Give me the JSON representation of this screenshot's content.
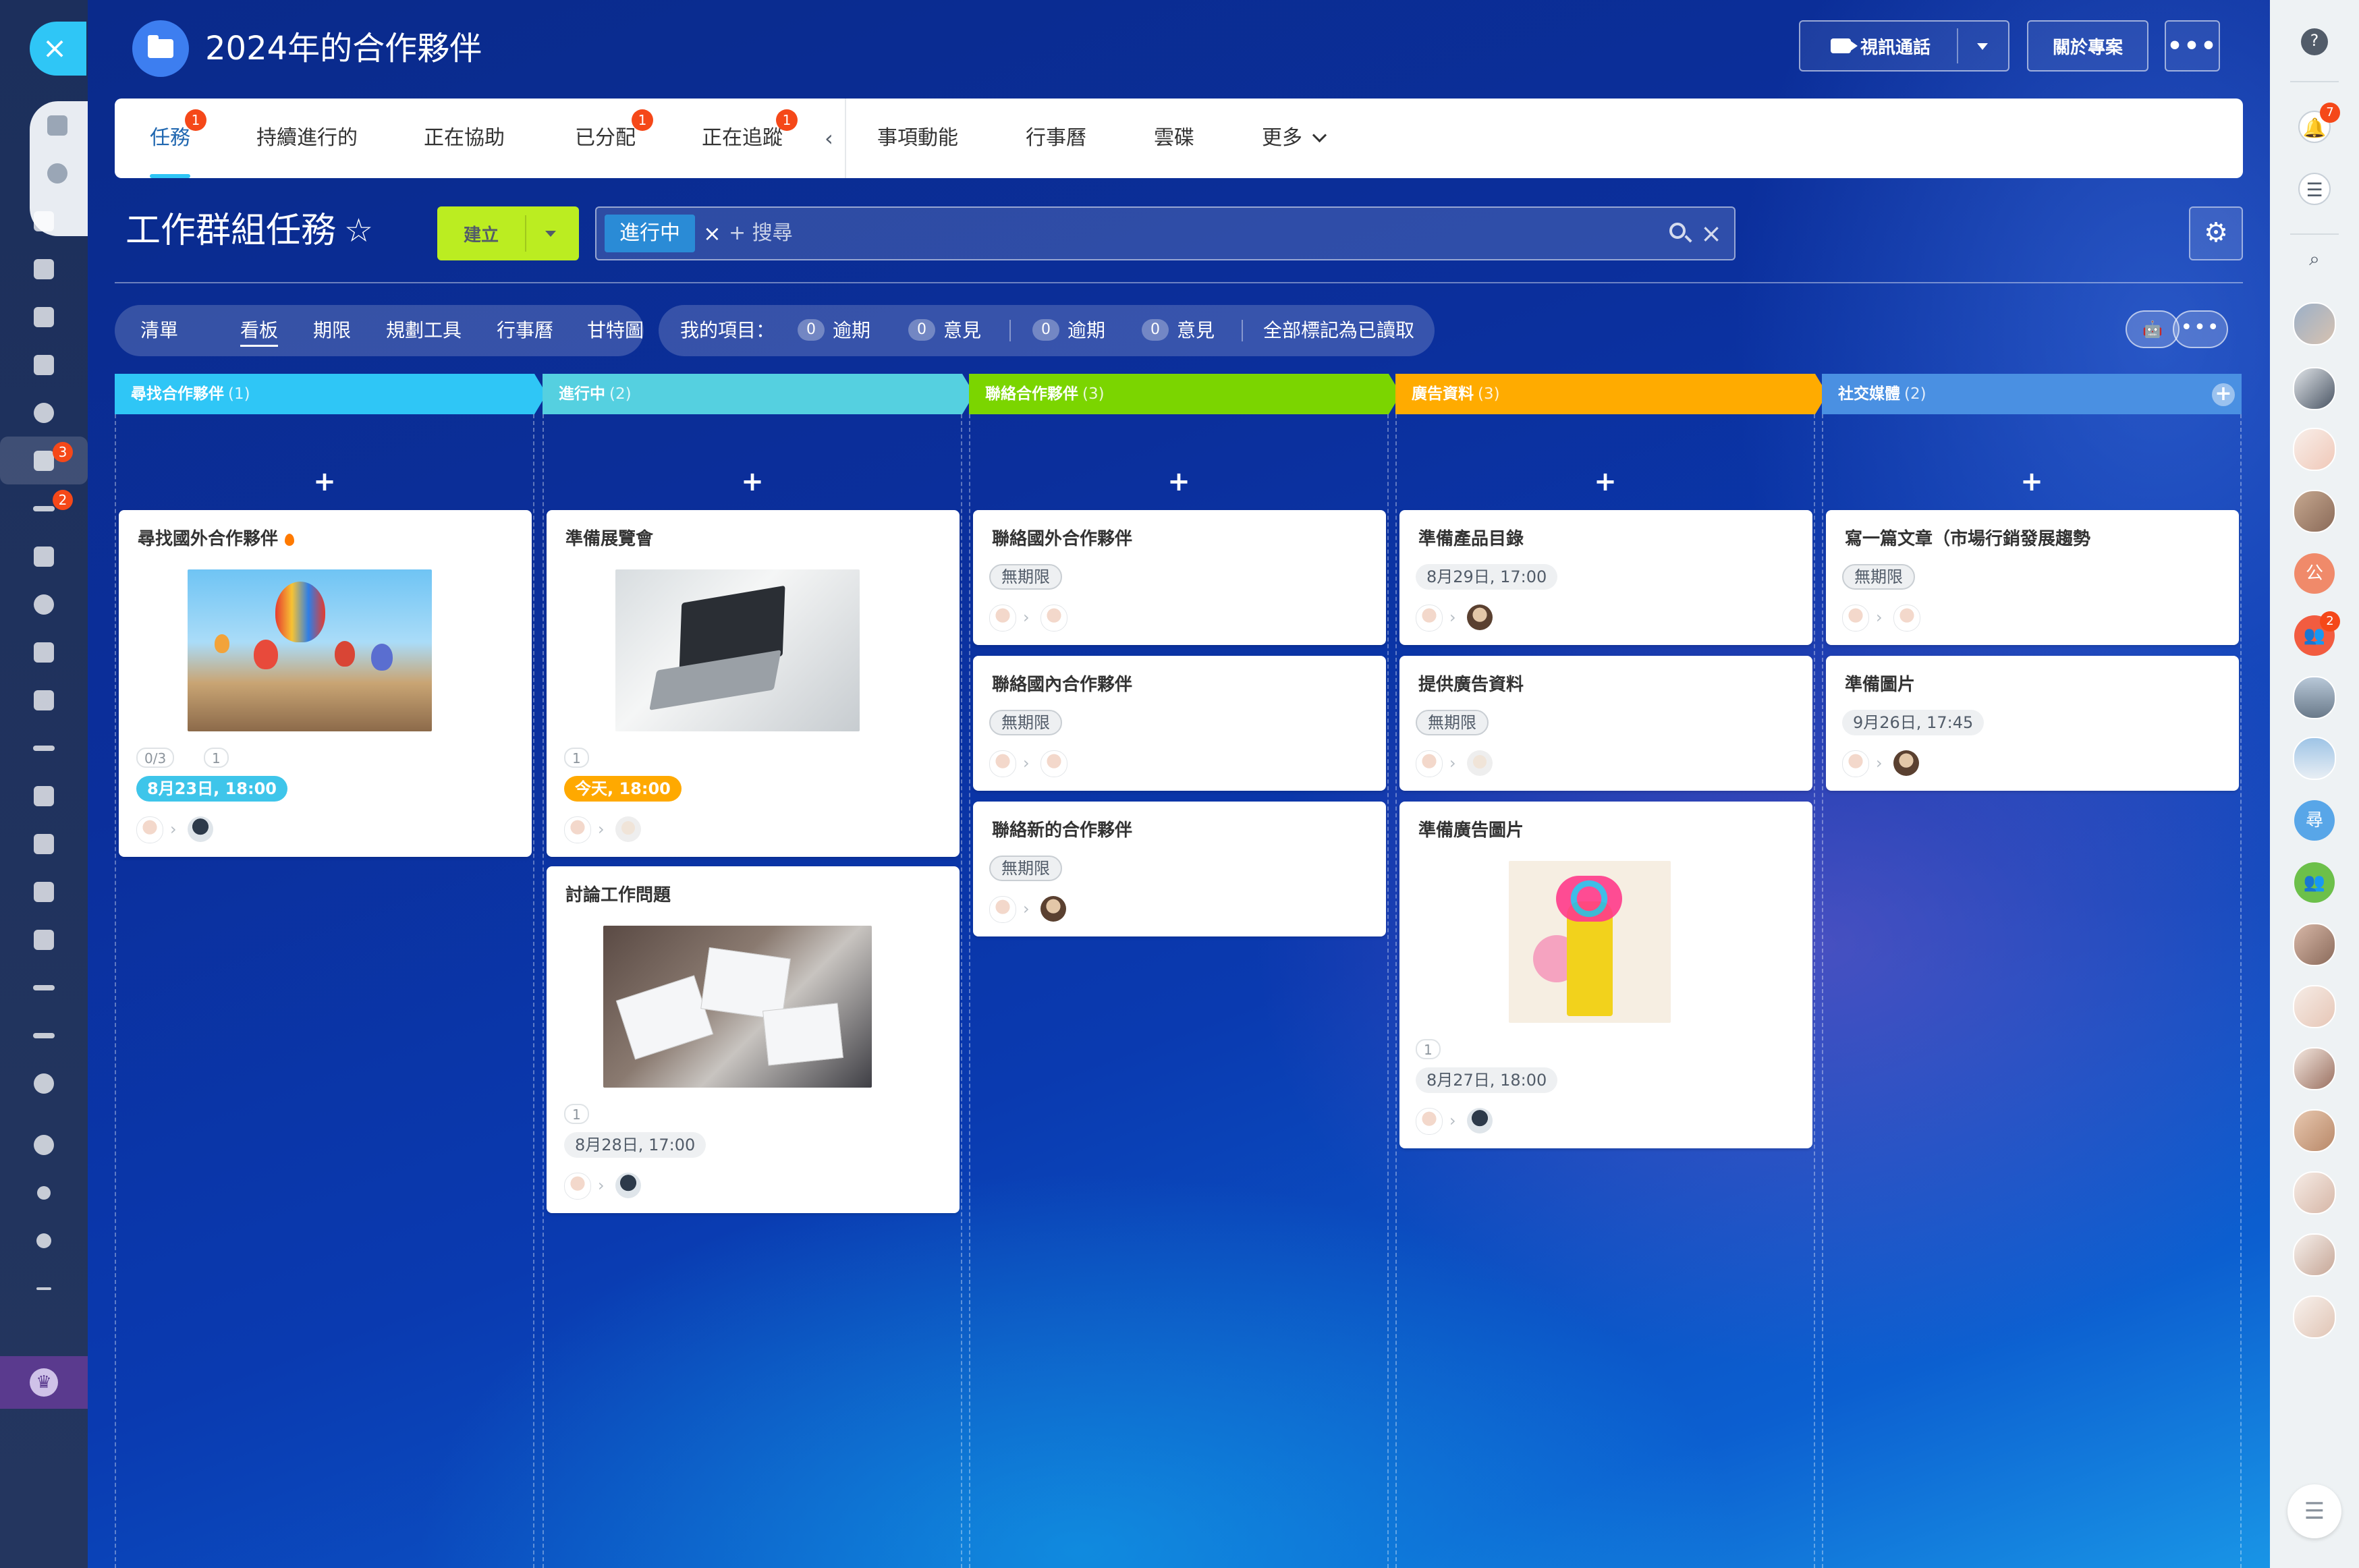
{
  "project": {
    "title": "2024年的合作夥伴",
    "video_call_label": "視訊通話",
    "about_label": "關於專案",
    "more_label": "•••"
  },
  "tabs": [
    {
      "label": "任務",
      "badge": "1"
    },
    {
      "label": "持續進行的",
      "badge": ""
    },
    {
      "label": "正在協助",
      "badge": ""
    },
    {
      "label": "已分配",
      "badge": "1"
    },
    {
      "label": "正在追蹤",
      "badge": "1"
    },
    {
      "label": "事項動能",
      "badge": ""
    },
    {
      "label": "行事曆",
      "badge": ""
    },
    {
      "label": "雲碟",
      "badge": ""
    },
    {
      "label": "更多",
      "badge": ""
    }
  ],
  "tabs_collapse_arrow": "‹",
  "page": {
    "title": "工作群組任務",
    "star": "☆",
    "create_label": "建立"
  },
  "search": {
    "chip": "進行中",
    "chip_remove": "×",
    "placeholder": "+ 搜尋",
    "clear": "×"
  },
  "settings_icon": "⚙",
  "views": [
    "清單",
    "看板",
    "期限",
    "規劃工具",
    "行事曆",
    "甘特圖"
  ],
  "counters": {
    "my_items_label": "我的項目：",
    "group1": [
      {
        "num": "0",
        "label": "逾期"
      },
      {
        "num": "0",
        "label": "意見"
      }
    ],
    "group2": [
      {
        "num": "0",
        "label": "逾期"
      },
      {
        "num": "0",
        "label": "意見"
      }
    ],
    "mark_all_read": "全部標記為已讀取"
  },
  "robot_icon": "🤖",
  "dots_label": "•••",
  "add_symbol": "+",
  "columns": [
    {
      "title": "尋找合作夥伴",
      "count": "(1)",
      "color": "#2fc6f6",
      "cards": [
        {
          "title": "尋找國外合作夥伴",
          "hot": true,
          "image": "balloons",
          "checklist": "0/3",
          "files": "1",
          "date": "8月23日, 18:00",
          "date_style": "blue"
        }
      ]
    },
    {
      "title": "進行中",
      "count": "(2)",
      "color": "#55d0e0",
      "cards": [
        {
          "title": "準備展覽會",
          "image": "laptop",
          "files": "1",
          "date": "今天, 18:00",
          "date_style": "orange"
        },
        {
          "title": "討論工作問題",
          "image": "meeting",
          "files": "1",
          "date": "8月28日, 17:00",
          "date_style": "plain"
        }
      ]
    },
    {
      "title": "聯絡合作夥伴",
      "count": "(3)",
      "color": "#7bd500",
      "cards": [
        {
          "title": "聯絡國外合作夥伴",
          "date": "無期限",
          "date_style": "gray"
        },
        {
          "title": "聯絡國內合作夥伴",
          "date": "無期限",
          "date_style": "gray"
        },
        {
          "title": "聯絡新的合作夥伴",
          "date": "無期限",
          "date_style": "gray"
        }
      ]
    },
    {
      "title": "廣告資料",
      "count": "(3)",
      "color": "#ffab00",
      "cards": [
        {
          "title": "準備產品目錄",
          "date": "8月29日, 17:00",
          "date_style": "plain"
        },
        {
          "title": "提供廣告資料",
          "date": "無期限",
          "date_style": "gray"
        },
        {
          "title": "準備廣告圖片",
          "image": "poster",
          "files": "1",
          "date": "8月27日, 18:00",
          "date_style": "plain"
        }
      ]
    },
    {
      "title": "社交媒體",
      "count": "(2)",
      "color": "#4a90e2",
      "cards": [
        {
          "title": "寫一篇文章（市場行銷發展趨勢",
          "date": "無期限",
          "date_style": "gray"
        },
        {
          "title": "準備圖片",
          "date": "9月26日, 17:45",
          "date_style": "plain"
        }
      ]
    }
  ],
  "left_sidebar": {
    "close": "×",
    "badges": {
      "tasks": "3",
      "feed": "2"
    }
  },
  "right_sidebar": {
    "help": "?",
    "notification_badge": "7",
    "letters": [
      {
        "text": "公",
        "color": "#f08a6a"
      },
      {
        "text": "尋",
        "color": "#58a6e8"
      }
    ],
    "group_badge": "2",
    "bottom_icon": "☰"
  }
}
